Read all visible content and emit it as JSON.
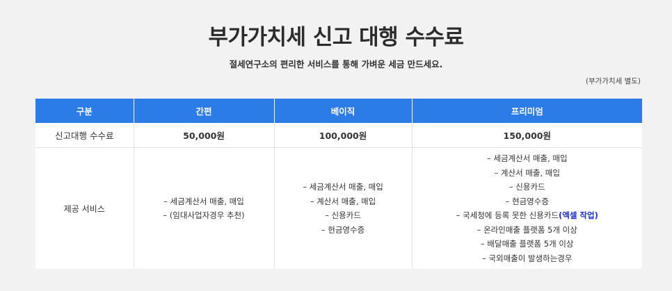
{
  "header": {
    "title": "부가가치세 신고 대행 수수료",
    "subtitle": "절세연구소의 편리한 서비스를 통해 가벼운 세금 만드세요.",
    "vat_note": "(부가가치세 별도)"
  },
  "table": {
    "columns": [
      "구분",
      "간편",
      "베이직",
      "프리미엄"
    ],
    "fee_row": {
      "label": "신고대행 수수료",
      "values": [
        "50,000원",
        "100,000원",
        "150,000원"
      ]
    },
    "service_row": {
      "label": "제공 서비스",
      "simple": [
        "– 세금계산서 매출, 매입",
        "– (임대사업자경우 추천)"
      ],
      "basic": [
        "– 세금계산서 매출, 매입",
        "– 계산서 매출, 매입",
        "– 신용카드",
        "– 현금영수증"
      ],
      "premium": [
        "– 세금계산서 매출, 매입",
        "– 계산서 매출, 매입",
        "– 신용카드",
        "– 현금영수증",
        "– 국세청에 등록 못한 신용카드",
        "– 온라인매출 플랫폼 5개 이상",
        "– 배달매출 플랫폼 5개 이상",
        "– 국외매출이 발생하는경우"
      ],
      "premium_highlight": "(엑셀 작업)"
    }
  },
  "colors": {
    "header_bg": "#2b7be9",
    "highlight": "#1b2fd8",
    "page_bg": "#f2f2f2"
  }
}
